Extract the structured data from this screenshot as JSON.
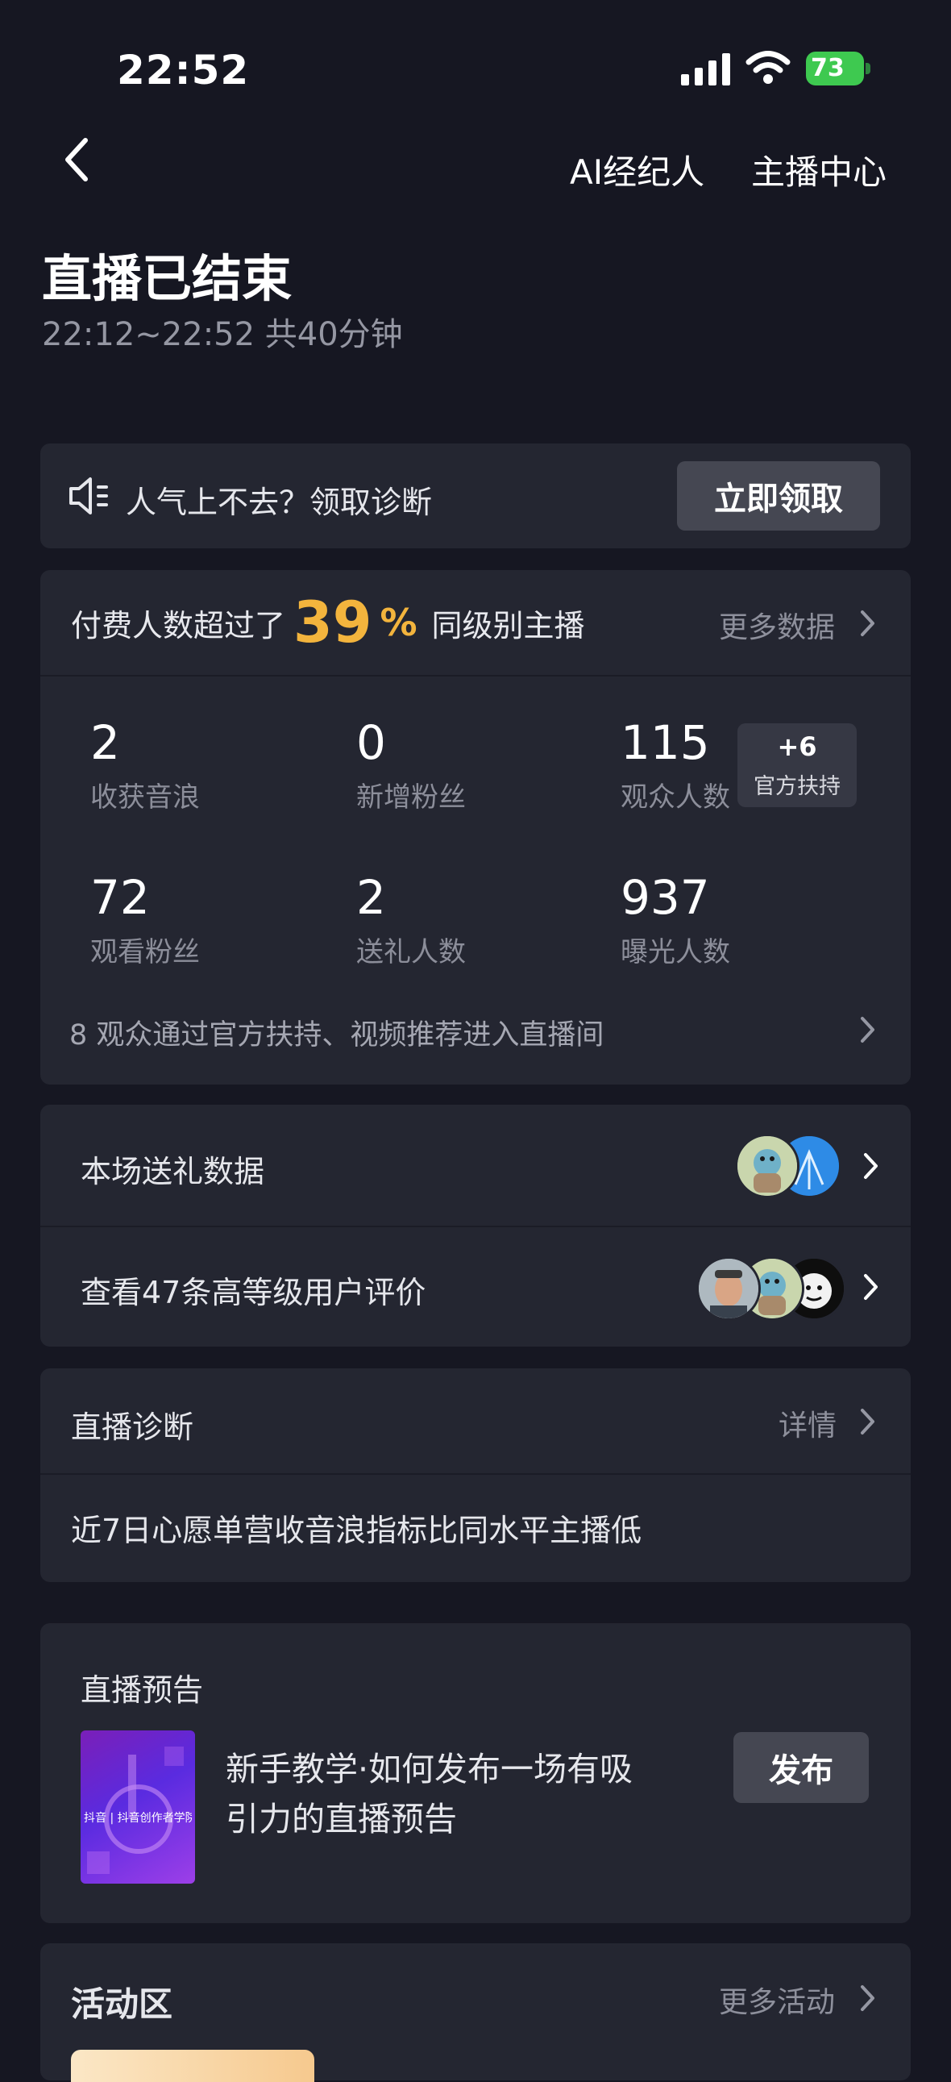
{
  "status_bar": {
    "time": "22:52",
    "battery": "73"
  },
  "header": {
    "ai_agent": "AI经纪人",
    "anchor_center": "主播中心"
  },
  "title": "直播已结束",
  "subtitle": "22:12~22:52 共40分钟",
  "promo": {
    "text": "人气上不去？领取诊断",
    "button": "立即领取"
  },
  "summary": {
    "prefix": "付费人数超过了",
    "percent": "39",
    "percent_sign": "%",
    "suffix": "同级别主播",
    "more_link": "更多数据"
  },
  "stats": [
    {
      "value": "2",
      "label": "收获音浪"
    },
    {
      "value": "0",
      "label": "新增粉丝"
    },
    {
      "value": "115",
      "label": "观众人数"
    },
    {
      "value": "72",
      "label": "观看粉丝"
    },
    {
      "value": "2",
      "label": "送礼人数"
    },
    {
      "value": "937",
      "label": "曝光人数"
    }
  ],
  "badge": {
    "value": "+6",
    "label": "官方扶持"
  },
  "recommend_note": "8 观众通过官方扶持、视频推荐进入直播间",
  "gift_data": "本场送礼数据",
  "reviews": "查看47条高等级用户评价",
  "diagnosis": {
    "title": "直播诊断",
    "detail": "详情",
    "message": "近7日心愿单营收音浪指标比同水平主播低"
  },
  "preview": {
    "title": "直播预告",
    "line1": "新手教学·如何发布一场有吸",
    "line2": "引力的直播预告",
    "button": "发布",
    "thumb_caption": "抖音 | 抖音创作者学院"
  },
  "activity": {
    "title": "活动区",
    "more": "更多活动"
  },
  "colors": {
    "background": "#161722",
    "card": "#242631",
    "accent": "#f3b43d",
    "button": "#454752"
  }
}
